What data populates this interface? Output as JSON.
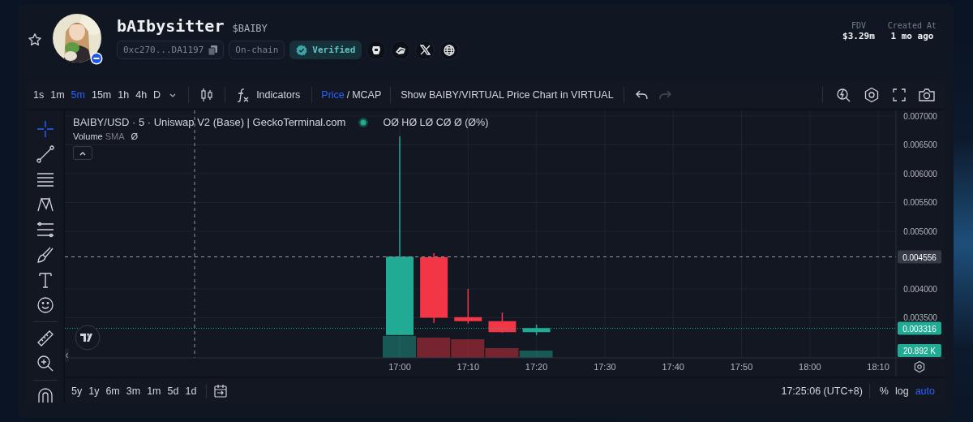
{
  "header": {
    "name": "bAIbysitter",
    "ticker": "$BAIBY",
    "address": "0xc270...DA1197",
    "chain_label": "On-chain",
    "verified": "Verified",
    "stats": [
      {
        "label": "FDV",
        "value": "$3.29m"
      },
      {
        "label": "Created At",
        "value": "1 mo ago"
      }
    ]
  },
  "toolbar": {
    "intervals": [
      {
        "label": "1s",
        "selected": false
      },
      {
        "label": "1m",
        "selected": false
      },
      {
        "label": "5m",
        "selected": true
      },
      {
        "label": "15m",
        "selected": false
      },
      {
        "label": "1h",
        "selected": false
      },
      {
        "label": "4h",
        "selected": false
      },
      {
        "label": "D",
        "selected": false
      }
    ],
    "indicators": "Indicators",
    "price_modes": [
      {
        "label": "Price",
        "selected": true
      },
      {
        "label": "MCAP",
        "selected": false
      }
    ],
    "price_mode_separator": "/",
    "pair_switch": "Show BAIBY/VIRTUAL Price Chart in VIRTUAL"
  },
  "chart": {
    "legend_title": "BAIBY/USD · 5 · Uniswap V2 (Base) | GeckoTerminal.com",
    "ohlc": "OØ HØ LØ CØ Ø (Ø%)",
    "volume_label": "Volume",
    "volume_sma": "SMA",
    "volume_value": "Ø",
    "crosshair_price": "0.004556",
    "last_price": "0.003316",
    "last_volume": "20.892 K",
    "price_axis_labels": [
      "0.007000",
      "0.006500",
      "0.006000",
      "0.005500",
      "0.005000",
      "0.004000",
      "0.003500"
    ],
    "time_axis_labels": [
      "17:00",
      "17:10",
      "17:20",
      "17:30",
      "17:40",
      "17:50",
      "18:00",
      "18:10"
    ]
  },
  "bottom_bar": {
    "ranges": [
      "5y",
      "1y",
      "6m",
      "3m",
      "1m",
      "5d",
      "1d"
    ],
    "time": "17:25:06 (UTC+8)",
    "scale_options": [
      {
        "label": "%",
        "selected": false
      },
      {
        "label": "log",
        "selected": false
      },
      {
        "label": "auto",
        "selected": true
      }
    ]
  }
}
